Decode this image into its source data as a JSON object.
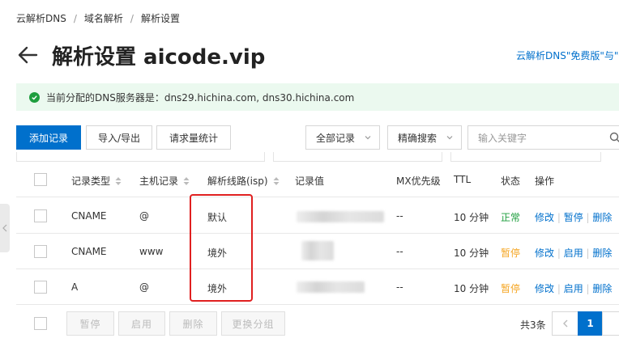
{
  "breadcrumb": {
    "items": [
      "云解析DNS",
      "域名解析",
      "解析设置"
    ],
    "separator": "/"
  },
  "header": {
    "title": "解析设置 aicode.vip",
    "promo_link": "云解析DNS\"免费版\"与\"付"
  },
  "notice": {
    "text": "当前分配的DNS服务器是：dns29.hichina.com, dns30.hichina.com",
    "status": "success"
  },
  "toolbar": {
    "add_label": "添加记录",
    "import_export_label": "导入/导出",
    "stats_label": "请求量统计",
    "record_filter": "全部记录",
    "search_mode": "精确搜索",
    "search_placeholder": "输入关键字"
  },
  "table": {
    "headers": {
      "type": "记录类型",
      "host": "主机记录",
      "line": "解析线路(isp)",
      "value": "记录值",
      "mx": "MX优先级",
      "ttl": "TTL",
      "status": "状态",
      "actions": "操作"
    },
    "rows": [
      {
        "type": "CNAME",
        "host": "@",
        "line": "默认",
        "mx": "--",
        "ttl": "10 分钟",
        "status": "正常",
        "status_kind": "normal",
        "actions": [
          "修改",
          "暂停",
          "删除"
        ]
      },
      {
        "type": "CNAME",
        "host": "www",
        "line": "境外",
        "mx": "--",
        "ttl": "10 分钟",
        "status": "暂停",
        "status_kind": "paused",
        "actions": [
          "修改",
          "启用",
          "删除"
        ]
      },
      {
        "type": "A",
        "host": "@",
        "line": "境外",
        "mx": "--",
        "ttl": "10 分钟",
        "status": "暂停",
        "status_kind": "paused",
        "actions": [
          "修改",
          "启用",
          "删除"
        ]
      }
    ]
  },
  "footer": {
    "pause_label": "暂停",
    "enable_label": "启用",
    "delete_label": "删除",
    "group_label": "更换分组",
    "total_text": "共3条",
    "current_page": "1"
  },
  "colors": {
    "primary": "#0070cc",
    "success": "#1e9e3e",
    "warning": "#f5a623",
    "highlight": "#e02020"
  }
}
